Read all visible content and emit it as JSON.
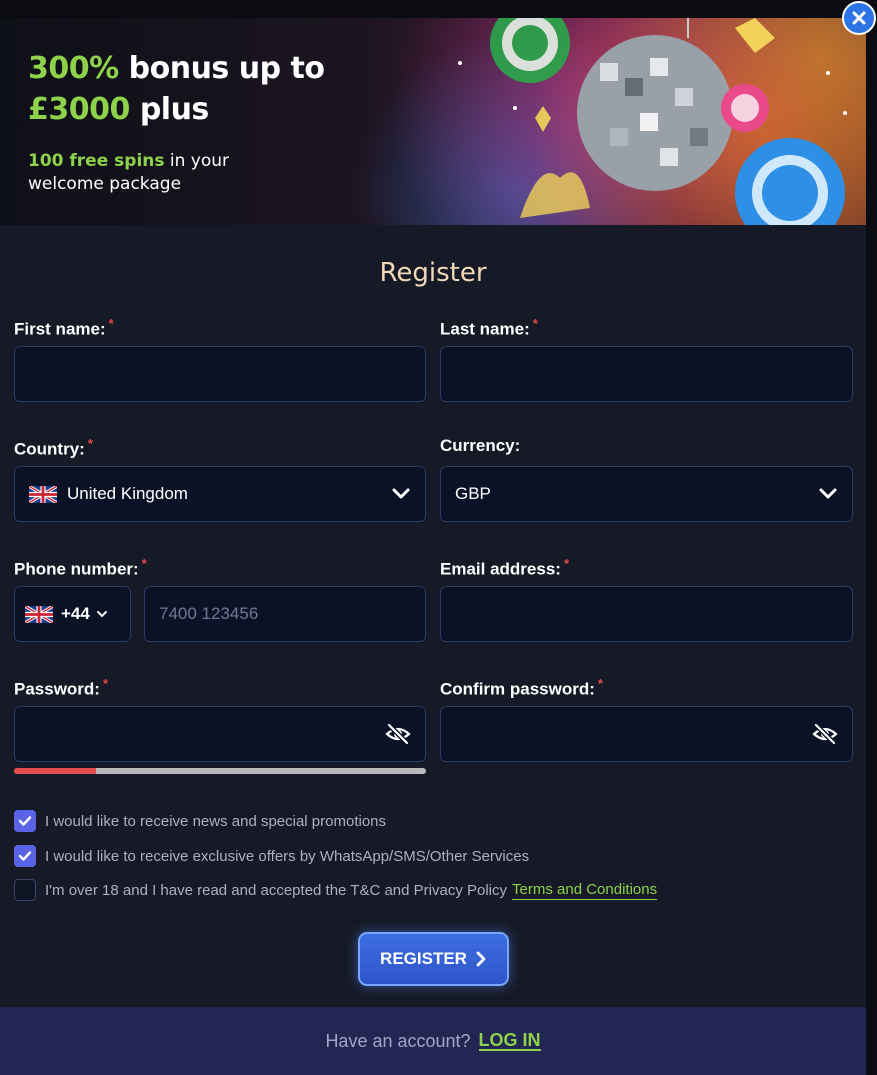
{
  "banner": {
    "headline_green": "300%",
    "headline_rest": " bonus up to",
    "headline_line2_green": "£3000",
    "headline_line2_rest": " plus",
    "sub_green": "100 free spins",
    "sub_rest1": " in your",
    "sub_line2": "welcome package"
  },
  "form": {
    "title": "Register",
    "first_name_label": "First name:",
    "last_name_label": "Last name:",
    "country_label": "Country:",
    "country_value": "United Kingdom",
    "currency_label": "Currency:",
    "currency_value": "GBP",
    "phone_label": "Phone number:",
    "phone_code": "+44",
    "phone_placeholder": "7400 123456",
    "email_label": "Email address:",
    "password_label": "Password:",
    "confirm_password_label": "Confirm password:",
    "required_mark": "*",
    "password_strength": 0.2
  },
  "checkboxes": [
    {
      "label": "I would like to receive news and special promotions",
      "checked": true
    },
    {
      "label": "I would like to receive exclusive offers by WhatsApp/SMS/Other Services",
      "checked": true
    },
    {
      "label": "I'm over 18 and I have read and accepted the T&C and Privacy Policy",
      "checked": false,
      "link": "Terms and Conditions"
    }
  ],
  "register_button": "REGISTER",
  "footer": {
    "prompt": "Have an account?",
    "login_link": "LOG IN"
  },
  "colors": {
    "accent_green": "#8ed14b",
    "button_blue": "#2e55c9",
    "required_red": "#e14a4a",
    "title_gold": "#f1d9b8"
  },
  "icons": {
    "close": "close-icon",
    "chevron": "chevron-down-icon",
    "eye": "eye-off-icon",
    "check": "check-icon",
    "flag": "uk-flag-icon",
    "arrow": "chevron-right-icon"
  }
}
